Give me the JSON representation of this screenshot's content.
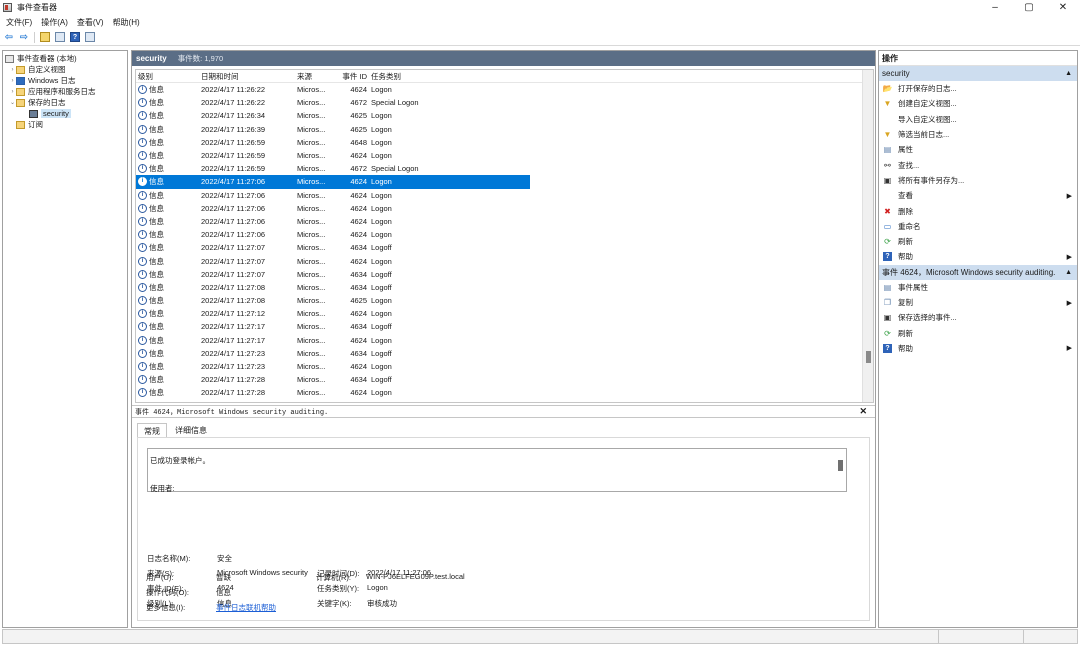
{
  "window": {
    "title": "事件查看器",
    "min": "–",
    "max": "▢",
    "close": "✕"
  },
  "menu": [
    "文件(F)",
    "操作(A)",
    "查看(V)",
    "帮助(H)"
  ],
  "toolbar": {
    "back": "⇦",
    "forward": "⇨",
    "help": "?"
  },
  "tree": {
    "root": "事件查看器 (本地)",
    "items": [
      "自定义视图",
      "Windows 日志",
      "应用程序和服务日志",
      "保存的日志",
      "security",
      "订阅"
    ]
  },
  "list": {
    "title": "security",
    "count": "事件数: 1,970",
    "columns": [
      "级别",
      "日期和时间",
      "来源",
      "事件 ID",
      "任务类别"
    ],
    "rows": [
      [
        "信息",
        "2022/4/17 11:26:22",
        "Micros...",
        "4624",
        "Logon"
      ],
      [
        "信息",
        "2022/4/17 11:26:22",
        "Micros...",
        "4672",
        "Special Logon"
      ],
      [
        "信息",
        "2022/4/17 11:26:34",
        "Micros...",
        "4625",
        "Logon"
      ],
      [
        "信息",
        "2022/4/17 11:26:39",
        "Micros...",
        "4625",
        "Logon"
      ],
      [
        "信息",
        "2022/4/17 11:26:59",
        "Micros...",
        "4648",
        "Logon"
      ],
      [
        "信息",
        "2022/4/17 11:26:59",
        "Micros...",
        "4624",
        "Logon"
      ],
      [
        "信息",
        "2022/4/17 11:26:59",
        "Micros...",
        "4672",
        "Special Logon"
      ],
      [
        "信息",
        "2022/4/17 11:27:06",
        "Micros...",
        "4624",
        "Logon"
      ],
      [
        "信息",
        "2022/4/17 11:27:06",
        "Micros...",
        "4624",
        "Logon"
      ],
      [
        "信息",
        "2022/4/17 11:27:06",
        "Micros...",
        "4624",
        "Logon"
      ],
      [
        "信息",
        "2022/4/17 11:27:06",
        "Micros...",
        "4624",
        "Logon"
      ],
      [
        "信息",
        "2022/4/17 11:27:06",
        "Micros...",
        "4624",
        "Logon"
      ],
      [
        "信息",
        "2022/4/17 11:27:07",
        "Micros...",
        "4634",
        "Logoff"
      ],
      [
        "信息",
        "2022/4/17 11:27:07",
        "Micros...",
        "4624",
        "Logon"
      ],
      [
        "信息",
        "2022/4/17 11:27:07",
        "Micros...",
        "4634",
        "Logoff"
      ],
      [
        "信息",
        "2022/4/17 11:27:08",
        "Micros...",
        "4634",
        "Logoff"
      ],
      [
        "信息",
        "2022/4/17 11:27:08",
        "Micros...",
        "4625",
        "Logon"
      ],
      [
        "信息",
        "2022/4/17 11:27:12",
        "Micros...",
        "4624",
        "Logon"
      ],
      [
        "信息",
        "2022/4/17 11:27:17",
        "Micros...",
        "4634",
        "Logoff"
      ],
      [
        "信息",
        "2022/4/17 11:27:17",
        "Micros...",
        "4624",
        "Logon"
      ],
      [
        "信息",
        "2022/4/17 11:27:23",
        "Micros...",
        "4634",
        "Logoff"
      ],
      [
        "信息",
        "2022/4/17 11:27:23",
        "Micros...",
        "4624",
        "Logon"
      ],
      [
        "信息",
        "2022/4/17 11:27:28",
        "Micros...",
        "4634",
        "Logoff"
      ],
      [
        "信息",
        "2022/4/17 11:27:28",
        "Micros...",
        "4624",
        "Logon"
      ]
    ],
    "selected_index": 7
  },
  "detail": {
    "header": "事件 4624，Microsoft Windows security auditing.",
    "close": "✕",
    "tabs": [
      "常规",
      "详细信息"
    ],
    "desc_line1": "已成功登录帐户。",
    "desc_line2": "使用者:",
    "fields": {
      "log_name_label": "日志名称(M):",
      "log_name": "安全",
      "source_label": "来源(S):",
      "source": "Microsoft Windows security",
      "logged_label": "记录时间(D):",
      "logged": "2022/4/17 11:27:06",
      "event_id_label": "事件 ID(E):",
      "event_id": "4624",
      "task_label": "任务类别(Y):",
      "task": "Logon",
      "level_label": "级别(L):",
      "level": "信息",
      "keywords_label": "关键字(K):",
      "keywords": "审核成功",
      "user_label": "用户(U):",
      "user": "暂缺",
      "computer_label": "计算机(R):",
      "computer": "WIN-PJ6ELFEG09P.test.local",
      "opcode_label": "操作代码(O):",
      "opcode": "信息",
      "more_label": "更多信息(I):",
      "more_link": "事件日志联机帮助"
    }
  },
  "actions": {
    "title": "操作",
    "section1": "security",
    "items1": [
      {
        "label": "打开保存的日志...",
        "icon": "folder-open-icon"
      },
      {
        "label": "创建自定义视图...",
        "icon": "filter-icon"
      },
      {
        "label": "导入自定义视图...",
        "icon": ""
      },
      {
        "label": "筛选当前日志...",
        "icon": "filter-icon"
      },
      {
        "label": "属性",
        "icon": "properties-icon"
      },
      {
        "label": "查找...",
        "icon": "binoculars-icon"
      },
      {
        "label": "将所有事件另存为...",
        "icon": "save-icon"
      },
      {
        "label": "查看",
        "icon": "",
        "submenu": true
      },
      {
        "label": "删除",
        "icon": "delete-icon"
      },
      {
        "label": "重命名",
        "icon": "rename-icon"
      },
      {
        "label": "刷新",
        "icon": "refresh-icon"
      },
      {
        "label": "帮助",
        "icon": "help-icon",
        "submenu": true
      }
    ],
    "section2": "事件 4624，Microsoft Windows security auditing.",
    "items2": [
      {
        "label": "事件属性",
        "icon": "properties-icon"
      },
      {
        "label": "复制",
        "icon": "copy-icon",
        "submenu": true
      },
      {
        "label": "保存选择的事件...",
        "icon": "save-icon"
      },
      {
        "label": "刷新",
        "icon": "refresh-icon"
      },
      {
        "label": "帮助",
        "icon": "help-icon",
        "submenu": true
      }
    ]
  },
  "colors": {
    "selection": "#0078d7",
    "header": "#5b6e86",
    "section": "#cdddef"
  }
}
